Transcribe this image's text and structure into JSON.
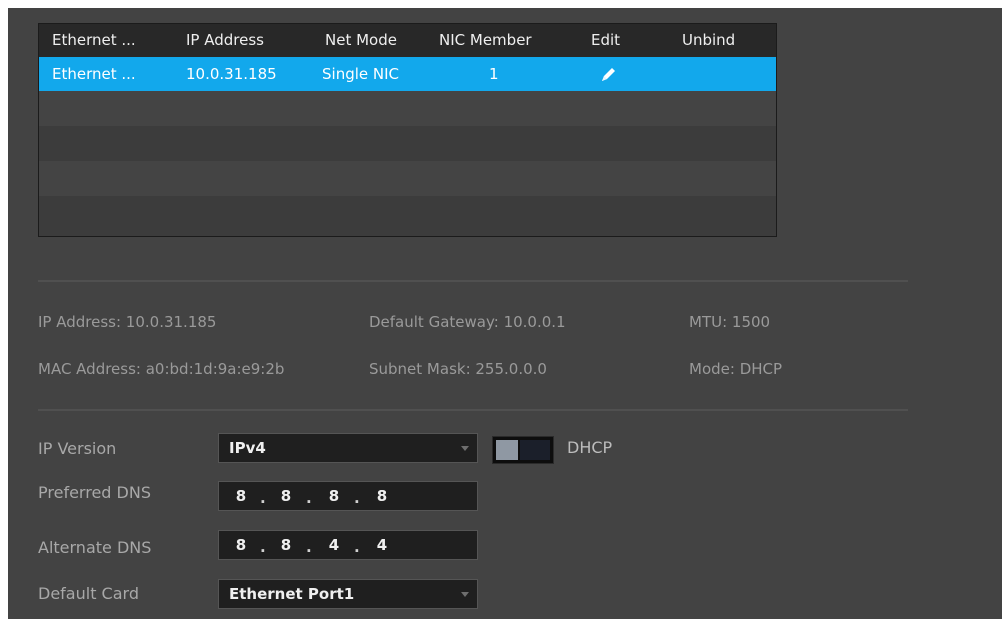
{
  "table": {
    "headers": [
      "Ethernet ...",
      "IP Address",
      "Net Mode",
      "NIC Member",
      "Edit",
      "Unbind"
    ],
    "rows": [
      {
        "ethernet": "Ethernet ...",
        "ip": "10.0.31.185",
        "mode": "Single NIC",
        "member": "1",
        "edit_icon": "pencil-icon",
        "unbind": ""
      }
    ]
  },
  "info": {
    "ip_address": "IP Address: 10.0.31.185",
    "default_gateway": "Default Gateway: 10.0.0.1",
    "mtu": "MTU: 1500",
    "mac_address": "MAC Address: a0:bd:1d:9a:e9:2b",
    "subnet_mask": "Subnet Mask: 255.0.0.0",
    "mode": "Mode: DHCP"
  },
  "form": {
    "ip_version": {
      "label": "IP Version",
      "value": "IPv4"
    },
    "dhcp": {
      "label": "DHCP",
      "state": "off"
    },
    "preferred_dns": {
      "label": "Preferred DNS",
      "octets": [
        "8",
        "8",
        "8",
        "8"
      ]
    },
    "alternate_dns": {
      "label": "Alternate DNS",
      "octets": [
        "8",
        "8",
        "4",
        "4"
      ]
    },
    "default_card": {
      "label": "Default Card",
      "value": "Ethernet Port1"
    }
  },
  "colors": {
    "panel_bg": "#434343",
    "header_bg": "#282828",
    "selected_row": "#12a8ec",
    "text_light": "#efefef",
    "text_dim": "#9a9a9a"
  }
}
